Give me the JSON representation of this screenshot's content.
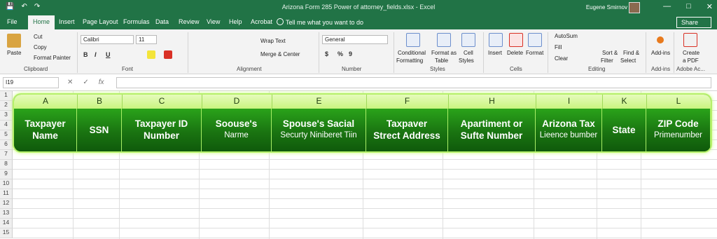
{
  "window": {
    "title": "Arizona Form 285 Power of attorney_fields.xlsx  -  Excel",
    "user": "Eugene Smirnov",
    "controls": [
      "—",
      "□",
      "✕"
    ]
  },
  "qat": {
    "save": "💾",
    "undo": "↶",
    "redo": "↷"
  },
  "menu": {
    "tabs": [
      "File",
      "Home",
      "Insert",
      "Page Layout",
      "Formulas",
      "Data",
      "Review",
      "View",
      "Help",
      "Acrobat"
    ],
    "active": "Home",
    "tell_me": "Tell me what you want to do",
    "share": "Share"
  },
  "ribbon": {
    "clipboard": {
      "paste": "Paste",
      "cut": "Cut",
      "copy": "Copy",
      "format_painter": "Format Painter",
      "label": "Clipboard"
    },
    "font": {
      "name": "Calibri",
      "size": "11",
      "label": "Font",
      "bold": "B",
      "italic": "I",
      "underline": "U"
    },
    "alignment": {
      "wrap_text": "Wrap Text",
      "merge_center": "Merge & Center",
      "label": "Alignment"
    },
    "number": {
      "format": "General",
      "label": "Number",
      "currency": "$",
      "percent": "%",
      "comma": "9"
    },
    "styles": {
      "conditional": "Conditional",
      "conditional2": "Formatting",
      "format_as": "Format as",
      "format_as2": "Table",
      "cell": "Cell",
      "cell2": "Styles",
      "label": "Styles"
    },
    "cells": {
      "insert": "Insert",
      "delete": "Delete",
      "format": "Format",
      "label": "Cells"
    },
    "editing": {
      "autosum": "AutoSum",
      "fill": "Fill",
      "clear": "Clear",
      "sort": "Sort &",
      "sort2": "Filter",
      "find": "Find &",
      "find2": "Select",
      "label": "Editing"
    },
    "addins": {
      "btn": "Add-ins",
      "label": "Add-ins"
    },
    "adobe": {
      "create": "Create",
      "create2": "a PDF",
      "label": "Adobe Ac..."
    }
  },
  "formula_bar": {
    "name_box": "I19",
    "fx": "fx",
    "cancel": "✕",
    "enter": "✓",
    "value": ""
  },
  "sheet": {
    "row_numbers": [
      "1",
      "2",
      "3",
      "4",
      "5",
      "6",
      "7",
      "8",
      "9",
      "10",
      "11",
      "12",
      "13",
      "14",
      "15"
    ],
    "columns": [
      {
        "letter": "A",
        "line1": "Taxpayer",
        "line2": "Name",
        "small": false
      },
      {
        "letter": "B",
        "line1": "SSN",
        "line2": "",
        "small": false
      },
      {
        "letter": "C",
        "line1": "Taxpayer ID",
        "line2": "Number",
        "small": false
      },
      {
        "letter": "D",
        "line1": "Soouse's",
        "line2": "Narme",
        "small": true
      },
      {
        "letter": "E",
        "line1": "Spouse's Sacial",
        "line2": "Securty Niniberet Tiin",
        "small": true
      },
      {
        "letter": "F",
        "line1": "Taxpaver",
        "line2": "Strect Address",
        "small": false
      },
      {
        "letter": "H",
        "line1": "Apartiment or",
        "line2": "Sufte Number",
        "small": false
      },
      {
        "letter": "I",
        "line1": "Arizona Tax",
        "line2": "Lieence bumber",
        "small": true
      },
      {
        "letter": "K",
        "line1": "State",
        "line2": "",
        "small": false
      },
      {
        "letter": "L",
        "line1": "ZIP Code",
        "line2": "Primenumber",
        "small": true
      }
    ]
  },
  "colors": {
    "excel_green": "#217346",
    "banner_green": "#1b7a14",
    "banner_glow": "#b5f06a"
  }
}
